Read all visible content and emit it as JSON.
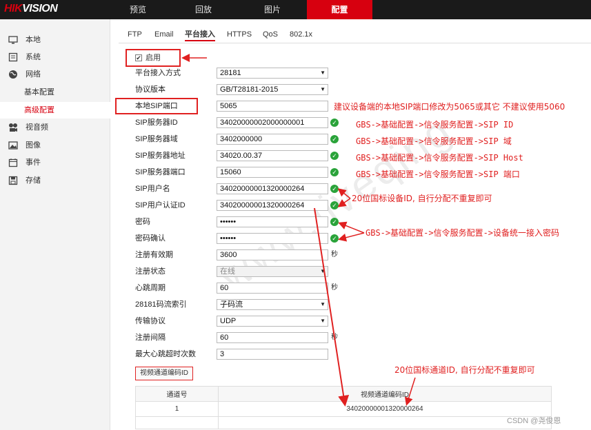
{
  "brand": {
    "logo_red": "HIK",
    "logo_white": "VISION"
  },
  "nav": [
    {
      "label": "预览",
      "active": false
    },
    {
      "label": "回放",
      "active": false
    },
    {
      "label": "图片",
      "active": false
    },
    {
      "label": "配置",
      "active": true
    }
  ],
  "sidebar": {
    "items": [
      {
        "label": "本地",
        "icon": "monitor-icon"
      },
      {
        "label": "系统",
        "icon": "system-icon"
      },
      {
        "label": "网络",
        "icon": "globe-icon"
      },
      {
        "label": "基本配置",
        "sub": true
      },
      {
        "label": "高级配置",
        "sub": true,
        "active": true
      },
      {
        "label": "视音频",
        "icon": "camera-audio-icon"
      },
      {
        "label": "图像",
        "icon": "image-icon"
      },
      {
        "label": "事件",
        "icon": "calendar-icon"
      },
      {
        "label": "存储",
        "icon": "save-icon"
      }
    ]
  },
  "tabs": [
    {
      "label": "FTP"
    },
    {
      "label": "Email"
    },
    {
      "label": "平台接入",
      "active": true
    },
    {
      "label": "HTTPS"
    },
    {
      "label": "QoS"
    },
    {
      "label": "802.1x"
    }
  ],
  "form": {
    "enable_label": "启用",
    "enable_checked": "✔",
    "rows": [
      {
        "label": "平台接入方式",
        "value": "28181",
        "kind": "select"
      },
      {
        "label": "协议版本",
        "value": "GB/T28181-2015",
        "kind": "select"
      },
      {
        "label": "本地SIP端口",
        "value": "5065",
        "kind": "text"
      },
      {
        "label": "SIP服务器ID",
        "value": "34020000002000000001",
        "kind": "text",
        "ok": true
      },
      {
        "label": "SIP服务器域",
        "value": "3402000000",
        "kind": "text",
        "ok": true
      },
      {
        "label": "SIP服务器地址",
        "value": "34020.00.37",
        "kind": "text",
        "ok": true
      },
      {
        "label": "SIP服务器端口",
        "value": "15060",
        "kind": "text",
        "ok": true
      },
      {
        "label": "SIP用户名",
        "value": "34020000001320000264",
        "kind": "text",
        "ok": true
      },
      {
        "label": "SIP用户认证ID",
        "value": "34020000001320000264",
        "kind": "text",
        "ok": true
      },
      {
        "label": "密码",
        "value": "••••••",
        "kind": "password",
        "ok": true
      },
      {
        "label": "密码确认",
        "value": "••••••",
        "kind": "password",
        "ok": true
      },
      {
        "label": "注册有效期",
        "value": "3600",
        "kind": "text",
        "unit": "秒"
      },
      {
        "label": "注册状态",
        "value": "在线",
        "kind": "select",
        "disabled": true
      },
      {
        "label": "心跳周期",
        "value": "60",
        "kind": "text",
        "unit": "秒"
      },
      {
        "label": "28181码流索引",
        "value": "子码流",
        "kind": "select"
      },
      {
        "label": "传输协议",
        "value": "UDP",
        "kind": "select"
      },
      {
        "label": "注册间隔",
        "value": "60",
        "kind": "text",
        "unit": "秒"
      },
      {
        "label": "最大心跳超时次数",
        "value": "3",
        "kind": "text"
      }
    ]
  },
  "channel": {
    "button_label": "视频通道编码ID",
    "headers": [
      "通道号",
      "视频通道编码ID"
    ],
    "rows": [
      {
        "channel": "1",
        "code": "34020000001320000264"
      }
    ]
  },
  "annotations": {
    "port_note": "建议设备端的本地SIP端口修改为5065或其它 不建议使用5060",
    "sip_id_note": "GBS->基础配置->信令服务配置->SIP ID",
    "sip_domain_note": "GBS->基础配置->信令服务配置->SIP 域",
    "sip_host_note": "GBS->基础配置->信令服务配置->SIP Host",
    "sip_port_note": "GBS->基础配置->信令服务配置->SIP 端口",
    "device_id_note": "20位国标设备ID, 自行分配不重复即可",
    "password_note": "GBS->基础配置->信令服务配置->设备统一接入密码",
    "channel_note": "20位国标通道ID, 自行分配不重复即可"
  },
  "watermark": "www.liveqing",
  "footer": {
    "csdn": "CSDN @尧俊恩"
  },
  "colors": {
    "brand_red": "#d7000f",
    "ok_green": "#2aa33a",
    "annotation_red": "#e02020"
  }
}
